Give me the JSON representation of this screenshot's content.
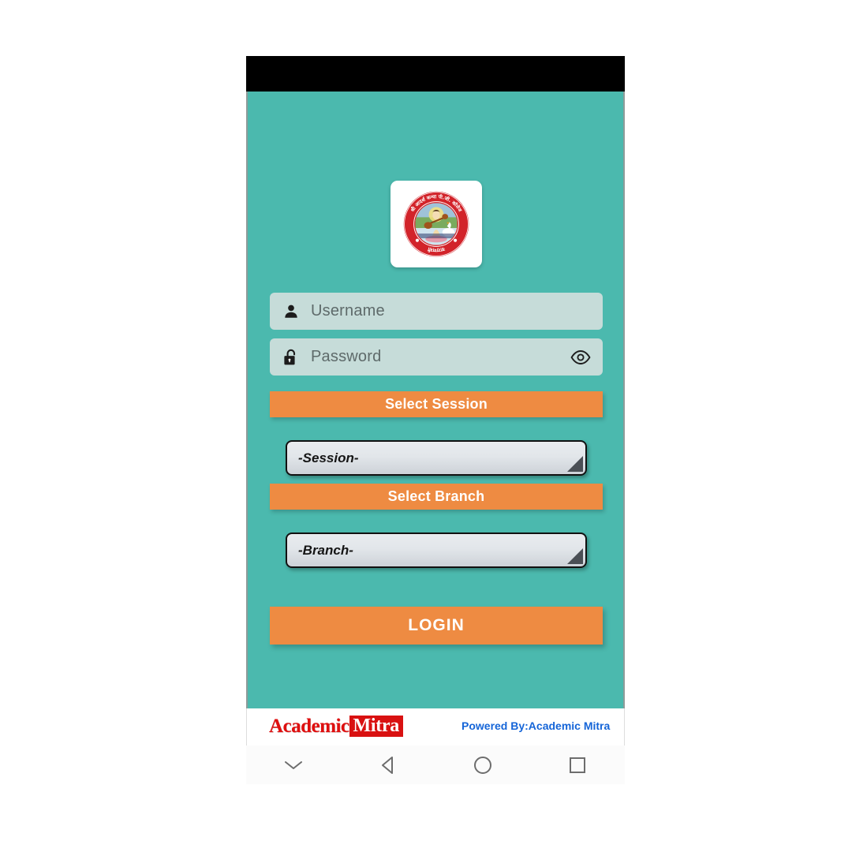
{
  "app": {
    "background_color": "#4bb9ae",
    "accent_color": "#ee8b42",
    "field_color": "#c6dcd9"
  },
  "logo": {
    "icon_name": "school-seal-saraswati",
    "ring_color": "#d2232a",
    "ring_text_top": "श्री आदर्श कन्या पी.जी. कॉलेज",
    "ring_text_bottom": "वाराणसी"
  },
  "form": {
    "username": {
      "placeholder": "Username",
      "value": "",
      "icon": "person-icon"
    },
    "password": {
      "placeholder": "Password",
      "value": "",
      "icon": "lock-open-icon",
      "toggle_icon": "eye-icon"
    },
    "session": {
      "header_label": "Select Session",
      "selected": "-Session-"
    },
    "branch": {
      "header_label": "Select Branch",
      "selected": "-Branch-"
    },
    "login_label": "LOGIN"
  },
  "footer": {
    "brand_first": "Academic",
    "brand_second": "Mitra",
    "powered_by": "Powered By:Academic Mitra"
  },
  "navbar": {
    "buttons": [
      {
        "name": "hide-keyboard-icon",
        "label": "Hide keyboard"
      },
      {
        "name": "back-icon",
        "label": "Back"
      },
      {
        "name": "home-icon",
        "label": "Home"
      },
      {
        "name": "recents-icon",
        "label": "Recents"
      }
    ]
  }
}
